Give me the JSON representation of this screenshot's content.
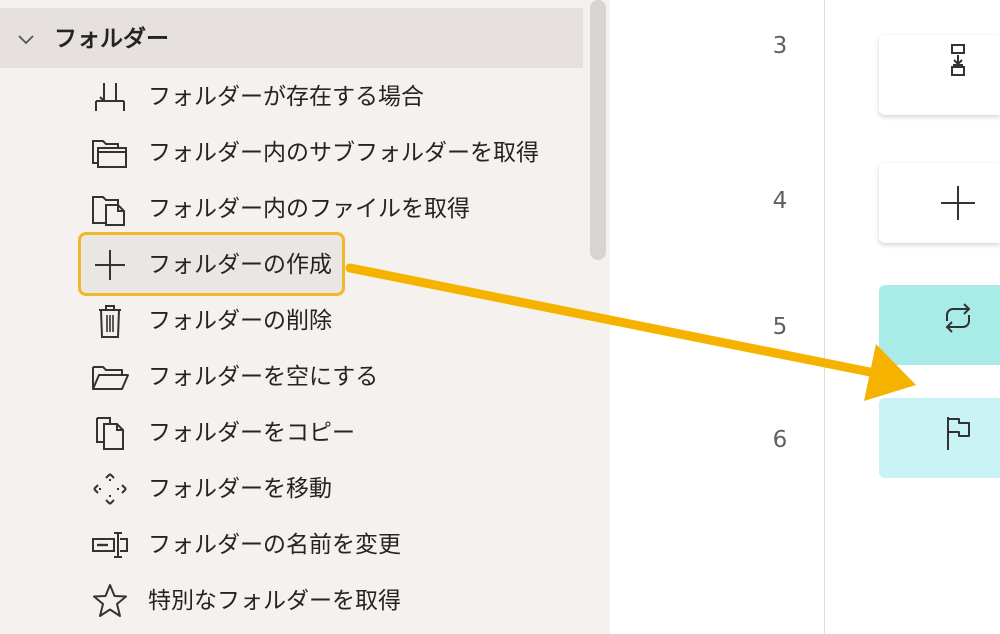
{
  "sidebar": {
    "group_title": "フォルダー",
    "items": [
      {
        "label": "フォルダーが存在する場合",
        "icon": "folder-exists-icon"
      },
      {
        "label": "フォルダー内のサブフォルダーを取得",
        "icon": "subfolders-icon"
      },
      {
        "label": "フォルダー内のファイルを取得",
        "icon": "folder-files-icon"
      },
      {
        "label": "フォルダーの作成",
        "icon": "plus-icon"
      },
      {
        "label": "フォルダーの削除",
        "icon": "trash-icon"
      },
      {
        "label": "フォルダーを空にする",
        "icon": "open-folder-icon"
      },
      {
        "label": "フォルダーをコピー",
        "icon": "copy-icon"
      },
      {
        "label": "フォルダーを移動",
        "icon": "move-icon"
      },
      {
        "label": "フォルダーの名前を変更",
        "icon": "rename-icon"
      },
      {
        "label": "特別なフォルダーを取得",
        "icon": "star-icon"
      }
    ]
  },
  "line_numbers": [
    "3",
    "4",
    "5",
    "6"
  ],
  "steps": [
    {
      "icon": "download-step-icon"
    },
    {
      "icon": "plus-icon"
    },
    {
      "icon": "loop-icon"
    },
    {
      "icon": "flag-icon"
    }
  ],
  "colors": {
    "highlight_border": "#f3b829",
    "arrow": "#f5b300",
    "loop_step": "#a9ebe7",
    "end_step": "#c9f3f5"
  }
}
